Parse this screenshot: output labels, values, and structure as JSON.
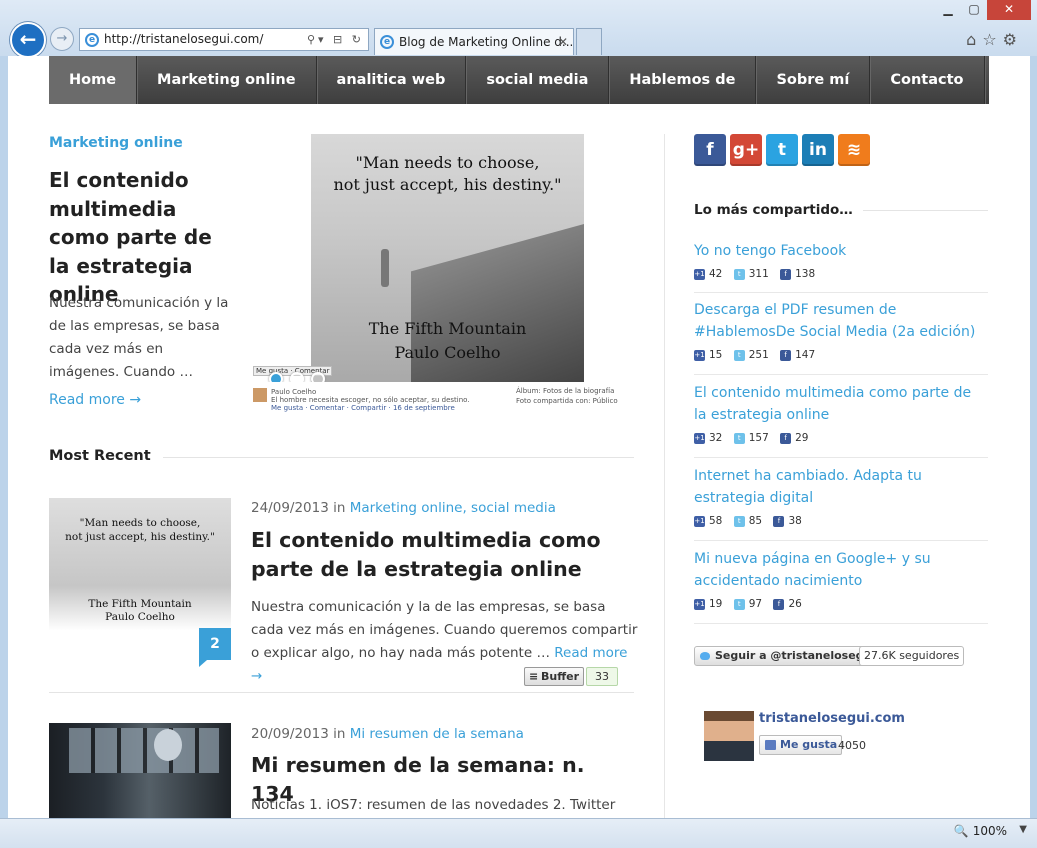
{
  "browser": {
    "url": "http://tristanelosegui.com/",
    "tab_title": "Blog de Marketing Online d...",
    "zoom": "100%"
  },
  "nav": [
    "Home",
    "Marketing online",
    "analitica web",
    "social media",
    "Hablemos de",
    "Sobre mí",
    "Contacto"
  ],
  "featured": {
    "category": "Marketing online",
    "title": "El contenido multimedia como parte de la estrategia online",
    "excerpt": "Nuestra comunicación y la de las empresas, se basa cada vez más en imágenes. Cuando …",
    "read_more": "Read more →",
    "image": {
      "quote_line1": "\"Man needs to choose,",
      "quote_line2": "not just accept, his destiny.\"",
      "book_line1": "The Fifth Mountain",
      "book_line2": "Paulo Coelho",
      "fb_author": "Paulo Coelho",
      "fb_text": "El hombre necesita escoger, no sólo aceptar, su destino.",
      "fb_actions": "Me gusta · Comentar · Compartir · 16 de septiembre",
      "fb_album": "Álbum: Fotos de la biografía",
      "fb_shared": "Foto compartida con: Público",
      "fb_like_btn": "Me gusta · Comentar"
    }
  },
  "most_recent": {
    "heading": "Most Recent",
    "posts": [
      {
        "date": "24/09/2013",
        "in": " in ",
        "categories": "Marketing online, social media",
        "title": "El contenido multimedia como parte de la estrategia online",
        "excerpt": "Nuestra comunicación y la de las empresas, se basa cada vez más en imágenes. Cuando queremos compartir o explicar algo, no hay nada más potente … ",
        "read_more": "Read more →",
        "comments": "2",
        "buffer_label": "Buffer",
        "buffer_count": "33",
        "thumb_quote1": "\"Man needs to choose,",
        "thumb_quote2": "not just accept, his destiny.\"",
        "thumb_book1": "The Fifth Mountain",
        "thumb_book2": "Paulo Coelho"
      },
      {
        "date": "20/09/2013",
        "in": " in ",
        "categories": "Mi resumen de la semana",
        "title": "Mi resumen de la semana: n. 134",
        "excerpt": "Noticias 1. iOS7: resumen de las novedades 2. Twitter"
      }
    ]
  },
  "sidebar": {
    "social_icons": [
      {
        "name": "facebook-icon",
        "glyph": "f",
        "color": "#3b5998"
      },
      {
        "name": "google-plus-icon",
        "glyph": "g+",
        "color": "#d34836"
      },
      {
        "name": "twitter-icon",
        "glyph": "t",
        "color": "#2ba3e1"
      },
      {
        "name": "linkedin-icon",
        "glyph": "in",
        "color": "#1c7eb6"
      },
      {
        "name": "rss-icon",
        "glyph": "≋",
        "color": "#f07c1c"
      }
    ],
    "most_shared_title": "Lo más compartido…",
    "most_shared": [
      {
        "title": "Yo no tengo Facebook",
        "gplus": "42",
        "twitter": "311",
        "facebook": "138"
      },
      {
        "title": "Descarga el PDF resumen de #HablemosDe Social Media (2a edición)",
        "gplus": "15",
        "twitter": "251",
        "facebook": "147"
      },
      {
        "title": "El contenido multimedia como parte de la estrategia online",
        "gplus": "32",
        "twitter": "157",
        "facebook": "29"
      },
      {
        "title": "Internet ha cambiado. Adapta tu estrategia digital",
        "gplus": "58",
        "twitter": "85",
        "facebook": "38"
      },
      {
        "title": "Mi nueva página en Google+ y su accidentado nacimiento",
        "gplus": "19",
        "twitter": "97",
        "facebook": "26"
      }
    ],
    "twitter_follow": "Seguir a @tristanelosegui",
    "twitter_followers": "27.6K seguidores",
    "fb_page_name": "tristanelosegui.com",
    "fb_like": "Me gusta",
    "fb_like_count": "4050"
  }
}
